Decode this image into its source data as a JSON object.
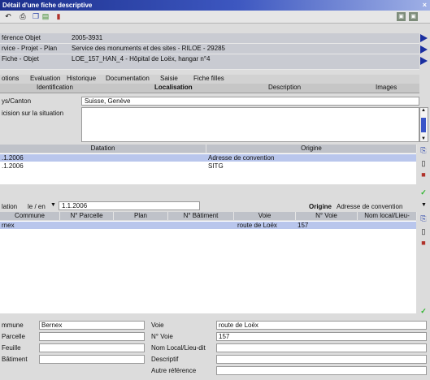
{
  "window": {
    "title": "Détail d'une fiche descriptive",
    "close": "×"
  },
  "toolbar": {
    "icons": [
      "undo-icon",
      "print-icon",
      "copy-icon",
      "image-icon",
      "book-icon"
    ],
    "right_icons": [
      "save-icon",
      "exit-icon"
    ]
  },
  "header": {
    "ref_label": "férence Objet",
    "ref_value": "2005-3931",
    "service_label": "rvice - Projet - Plan",
    "service_value": "Service des monuments et des sites - RILOE - 29285",
    "fiche_label": "Fiche - Objet",
    "fiche_value": "LOE_157_HAN_4 - Hôpital de Loëx, hangar n°4"
  },
  "tabs_main": [
    "otions",
    "Evaluation",
    "Historique",
    "Documentation",
    "Saisie",
    "Fiche filles"
  ],
  "tabs_sub": [
    "Identification",
    "Localisation",
    "Description",
    "Images"
  ],
  "location": {
    "pays_label": "ys/Canton",
    "pays_value": "Suisse, Genève",
    "precision_label": "icision sur la situation",
    "precision_value": ""
  },
  "datation_table": {
    "headers": [
      "Datation",
      "Origine"
    ],
    "rows": [
      {
        "date": ".1.2006",
        "origine": "Adresse de convention"
      },
      {
        "date": ".1.2006",
        "origine": "SITG"
      }
    ]
  },
  "address_filter": {
    "label": "lation",
    "mode": "le / en",
    "date": "1.1.2006",
    "origine_label": "Origine",
    "origine_value": "Adresse de convention"
  },
  "address_table": {
    "headers": [
      "Commune",
      "N° Parcelle",
      "Plan",
      "N° Bâtiment",
      "Voie",
      "N° Voie",
      "Nom local/Lieu-"
    ],
    "rows": [
      {
        "commune": "rnex",
        "parcelle": "",
        "plan": "",
        "batiment": "",
        "voie": "route de Loëx",
        "no_voie": "157",
        "lieu": ""
      }
    ]
  },
  "details": {
    "commune_label": "mmune",
    "commune_value": "Bernex",
    "parcelle_label": "Parcelle",
    "parcelle_value": "",
    "feuille_label": "Feuille",
    "feuille_value": "",
    "batiment_label": "Bâtiment",
    "batiment_value": "",
    "voie_label": "Voie",
    "voie_value": "route de Loëx",
    "novoie_label": "N° Voie",
    "novoie_value": "157",
    "lieu_label": "Nom Local/Lieu-dit",
    "lieu_value": "",
    "descriptif_label": "Descriptif",
    "descriptif_value": "",
    "autre_label": "Autre référence",
    "autre_value": ""
  },
  "colors": {
    "accent": "#1a2fa0",
    "selection": "#b9c6ec",
    "header": "#c9cbd2",
    "check": "#2bb52b"
  }
}
